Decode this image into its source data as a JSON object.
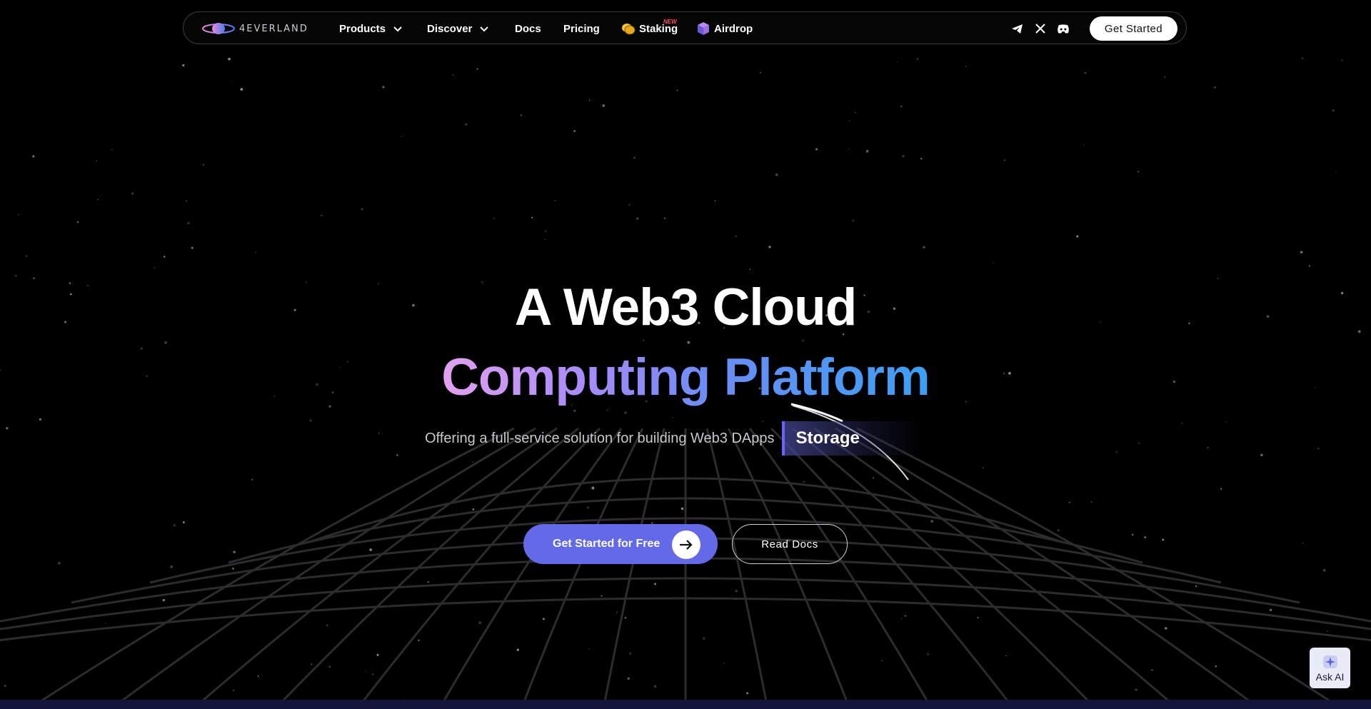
{
  "nav": {
    "brand": "4EVERLAND",
    "items": [
      {
        "label": "Products",
        "has_dropdown": true
      },
      {
        "label": "Discover",
        "has_dropdown": true
      },
      {
        "label": "Docs",
        "has_dropdown": false
      },
      {
        "label": "Pricing",
        "has_dropdown": false
      },
      {
        "label": "Staking",
        "has_dropdown": false,
        "badge": "NEW",
        "icon": "coin-icon"
      },
      {
        "label": "Airdrop",
        "has_dropdown": false,
        "icon": "cube-icon"
      }
    ],
    "social": [
      "telegram-icon",
      "x-icon",
      "discord-icon"
    ],
    "cta_label": "Get Started"
  },
  "hero": {
    "title_line1": "A Web3 Cloud",
    "title_line2": "Computing Platform",
    "subtitle": "Offering a full-service solution for building Web3 DApps",
    "rotating_word": "Storage",
    "primary_cta": "Get Started for Free",
    "secondary_cta": "Read Docs"
  },
  "assistant": {
    "label": "Ask AI"
  },
  "colors": {
    "background": "#000000",
    "primary_button": "#6469e8",
    "gradient_start": "#e6a2ef",
    "gradient_end": "#3aa0f5",
    "accent_bar": "#6c63ff",
    "badge": "#ff4d6d"
  }
}
